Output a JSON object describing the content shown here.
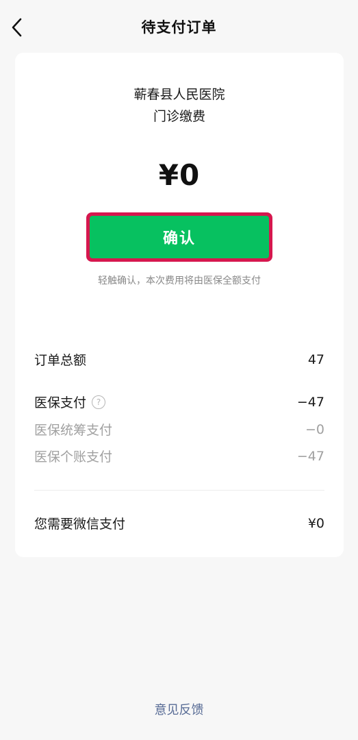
{
  "nav": {
    "title": "待支付订单",
    "back_icon": "chevron-left-icon"
  },
  "order": {
    "hospital": "蕲春县人民医院",
    "service": "门诊缴费",
    "amount": "¥0",
    "confirm_label": "确认",
    "hint": "轻触确认，本次费用将由医保全额支付"
  },
  "details": {
    "total_label": "订单总额",
    "total_value": "47",
    "insurance_label": "医保支付",
    "insurance_help_icon": "question-circle-icon",
    "insurance_help_glyph": "?",
    "insurance_value": "−47",
    "pooled_label": "医保统筹支付",
    "pooled_value": "−0",
    "personal_label": "医保个账支付",
    "personal_value": "−47",
    "wechat_label": "您需要微信支付",
    "wechat_value": "¥0"
  },
  "footer": {
    "feedback_label": "意见反馈"
  },
  "colors": {
    "brand_green": "#07c160",
    "highlight_red": "#d6174e",
    "link_blue": "#576b95",
    "muted_gray": "#a0a0a0",
    "background": "#f7f7f7"
  }
}
